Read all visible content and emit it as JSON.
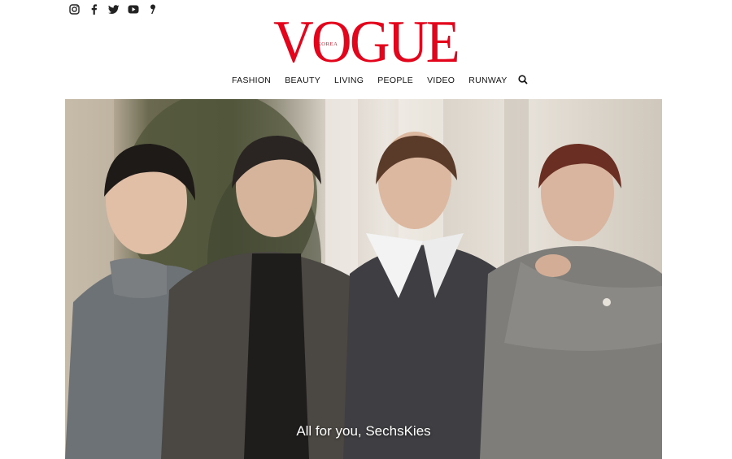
{
  "social": {
    "icons": [
      "instagram-icon",
      "facebook-icon",
      "twitter-icon",
      "youtube-icon",
      "naver-post-icon"
    ]
  },
  "brand": {
    "logo": "VOGUE",
    "edition": "KOREA",
    "color": "#e3051b"
  },
  "nav": {
    "items": [
      "FASHION",
      "BEAUTY",
      "LIVING",
      "PEOPLE",
      "VIDEO",
      "RUNWAY"
    ],
    "search_icon": "search-icon"
  },
  "hero": {
    "caption": "All for you, SechsKies"
  }
}
